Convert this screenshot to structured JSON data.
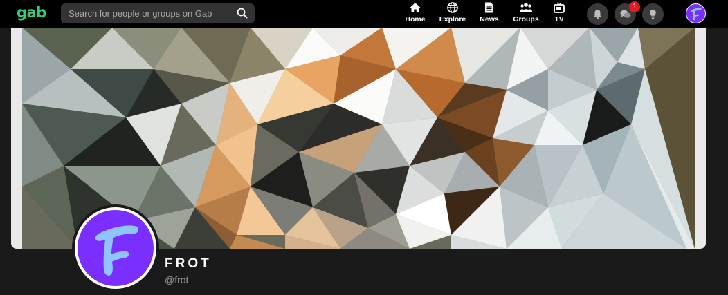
{
  "brand": {
    "logo": "gab",
    "accent": "#30ce7d"
  },
  "search": {
    "placeholder": "Search for people or groups on Gab"
  },
  "nav": {
    "items": [
      {
        "label": "Home",
        "icon": "home-icon"
      },
      {
        "label": "Explore",
        "icon": "globe-icon"
      },
      {
        "label": "News",
        "icon": "news-icon"
      },
      {
        "label": "Groups",
        "icon": "groups-icon"
      },
      {
        "label": "TV",
        "icon": "tv-icon"
      }
    ],
    "actions": [
      {
        "name": "notifications",
        "icon": "bell-icon"
      },
      {
        "name": "chats",
        "icon": "chat-icon",
        "badge": "1"
      },
      {
        "name": "theme",
        "icon": "lightbulb-icon"
      }
    ]
  },
  "profile": {
    "display_name": "FROT",
    "handle": "@frot",
    "avatar_letter": "F",
    "avatar_color": "#7b2fff"
  },
  "colors": {
    "badge": "#e41b23",
    "background": "#1a1a1a"
  }
}
